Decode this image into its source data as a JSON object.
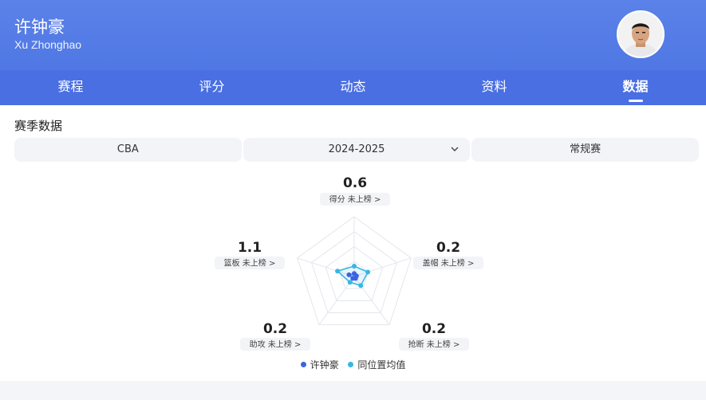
{
  "player": {
    "name": "许钟豪",
    "name_en": "Xu Zhonghao"
  },
  "tabs": [
    {
      "label": "赛程"
    },
    {
      "label": "评分"
    },
    {
      "label": "动态"
    },
    {
      "label": "资料"
    },
    {
      "label": "数据"
    }
  ],
  "active_tab": "数据",
  "section_title": "赛季数据",
  "filters": {
    "league": "CBA",
    "season": "2024-2025",
    "type": "常规赛"
  },
  "radar": {
    "axes": [
      {
        "key": "points",
        "value": "0.6",
        "label": "得分",
        "rank": "未上榜"
      },
      {
        "key": "blocks",
        "value": "0.2",
        "label": "盖帽",
        "rank": "未上榜"
      },
      {
        "key": "steals",
        "value": "0.2",
        "label": "抢断",
        "rank": "未上榜"
      },
      {
        "key": "assists",
        "value": "0.2",
        "label": "助攻",
        "rank": "未上榜"
      },
      {
        "key": "rebounds",
        "value": "1.1",
        "label": "篮板",
        "rank": "未上榜"
      }
    ]
  },
  "chart_data": {
    "type": "radar",
    "categories": [
      "得分",
      "盖帽",
      "抢断",
      "助攻",
      "篮板"
    ],
    "series": [
      {
        "name": "许钟豪",
        "values": [
          0.6,
          0.2,
          0.2,
          0.2,
          1.1
        ]
      },
      {
        "name": "同位置均值",
        "values": []
      }
    ]
  },
  "legend": [
    {
      "label": "许钟豪",
      "color": "#3d63e0"
    },
    {
      "label": "同位置均值",
      "color": "#37b7e6"
    }
  ],
  "colors": {
    "header": "#4a72e2",
    "player_series": "#3d63e0",
    "average_series": "#37b7e6"
  }
}
